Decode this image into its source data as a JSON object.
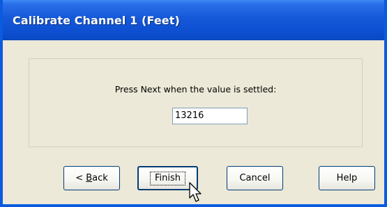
{
  "window": {
    "title": "Calibrate Channel 1 (Feet)"
  },
  "dialog": {
    "prompt": "Press Next when the value is settled:",
    "value": "13216"
  },
  "buttons": {
    "back_prefix": "< ",
    "back_mnemonic": "B",
    "back_rest": "ack",
    "finish": "Finish",
    "cancel": "Cancel",
    "help": "Help"
  },
  "colors": {
    "titlebar": "#0A5BE0",
    "dialog_bg": "#ECE9D8"
  },
  "icons": {
    "cursor": "arrow-cursor-icon"
  }
}
